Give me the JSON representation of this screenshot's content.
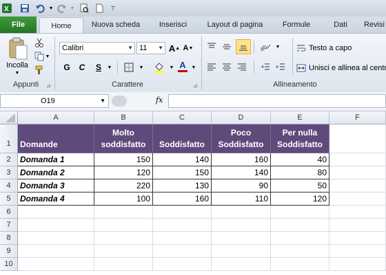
{
  "toolbar": {
    "icons": [
      "excel-icon",
      "save-icon",
      "undo-icon",
      "redo-icon",
      "print-preview-icon",
      "new-icon",
      "customize-icon"
    ]
  },
  "tabs": {
    "file": "File",
    "home": "Home",
    "items": [
      "Nuova scheda",
      "Inserisci",
      "Layout di pagina",
      "Formule",
      "Dati",
      "Revisi"
    ]
  },
  "ribbon": {
    "clipboard": {
      "paste": "Incolla",
      "label": "Appunti"
    },
    "font": {
      "name": "Calibri",
      "size": "11",
      "label": "Carattere",
      "bold": "G",
      "italic": "C",
      "underline": "S",
      "grow": "A",
      "shrink": "A",
      "color_letter": "A"
    },
    "alignment": {
      "wrap": "Testo a capo",
      "merge": "Unisci e allinea al centro",
      "label": "Allineamento"
    }
  },
  "formula_bar": {
    "name_box": "O19",
    "fx": "fx",
    "value": ""
  },
  "sheet": {
    "columns": [
      "A",
      "B",
      "C",
      "D",
      "E",
      "F"
    ],
    "rows": [
      "1",
      "2",
      "3",
      "4",
      "5",
      "6",
      "7",
      "8",
      "9",
      "10"
    ],
    "header": [
      "Domande",
      "Molto\nsoddisfatto",
      "Soddisfatto",
      "Poco\nSoddisfatto",
      "Per nulla\nSoddisfatto"
    ],
    "data": [
      [
        "Domanda 1",
        "150",
        "140",
        "160",
        "40"
      ],
      [
        "Domanda 2",
        "120",
        "150",
        "140",
        "80"
      ],
      [
        "Domanda 3",
        "220",
        "130",
        "90",
        "50"
      ],
      [
        "Domanda 4",
        "100",
        "160",
        "110",
        "120"
      ]
    ]
  },
  "colors": {
    "header_fill": "#604a7b",
    "file_tab": "#2e8a34"
  }
}
